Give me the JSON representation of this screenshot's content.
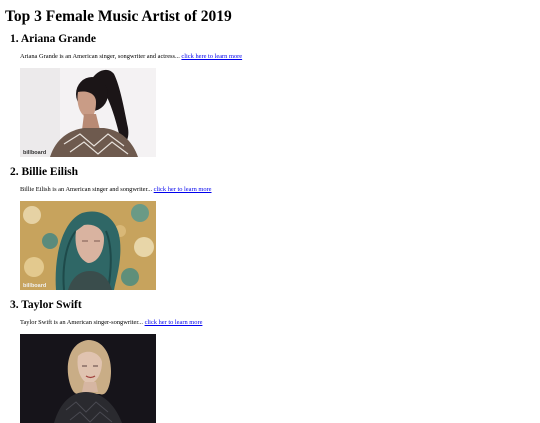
{
  "page": {
    "title": "Top 3 Female Music Artist of 2019"
  },
  "artists": [
    {
      "heading": "1. Ariana Grande",
      "description": "Ariana Grande is an American singer, songwriter and actress...",
      "link_text": "click here to learn more",
      "photo_watermark": "billboard",
      "photo_palette": {
        "background": "#f4f2f3",
        "hair": "#1b1517",
        "skin": "#c99c86",
        "outfit": "#6e5a4e"
      }
    },
    {
      "heading": "2. Billie Eilish",
      "description": "Billie Eilish is an American singer and songwriter...",
      "link_text": "click her to learn more",
      "photo_watermark": "billboard",
      "photo_palette": {
        "background": "#c7a35d",
        "hair": "#2f6766",
        "skin": "#d9b3a0",
        "outfit": "#3a4d4c"
      }
    },
    {
      "heading": "3. Taylor Swift",
      "description": "Taylor Swift is an American singer-songwriter...",
      "link_text": "click her to learn more",
      "photo_watermark": "",
      "photo_palette": {
        "background": "#16141a",
        "hair": "#c9ad86",
        "skin": "#e0c3b0",
        "outfit": "#2a2a2f"
      }
    }
  ]
}
